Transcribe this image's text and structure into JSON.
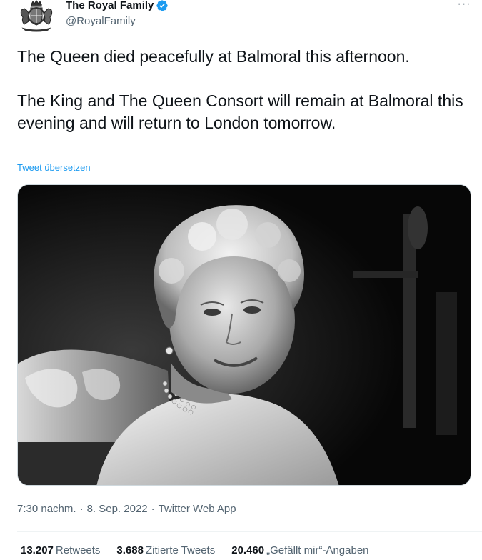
{
  "tweet": {
    "author": {
      "display_name": "The Royal Family",
      "handle": "@RoyalFamily",
      "verified": true
    },
    "more_label": "···",
    "text": {
      "paragraph1": "The Queen died peacefully at Balmoral this afternoon.",
      "paragraph2": "The King and The Queen Consort will remain at Balmoral this evening and will return to London tomorrow."
    },
    "translate_label": "Tweet übersetzen",
    "meta": {
      "time": "7:30 nachm.",
      "date": "8. Sep. 2022",
      "source": "Twitter Web App",
      "separator": "·"
    },
    "stats": {
      "retweets_count": "13.207",
      "retweets_label": "Retweets",
      "quotes_count": "3.688",
      "quotes_label": "Zitierte Tweets",
      "likes_count": "20.460",
      "likes_label": "„Gefällt mir“-Angaben"
    },
    "colors": {
      "accent": "#1d9bf0",
      "text_primary": "#0f1419",
      "text_secondary": "#536471"
    },
    "icons": {
      "verified": "verified-badge-icon",
      "more": "more-options-icon"
    }
  }
}
